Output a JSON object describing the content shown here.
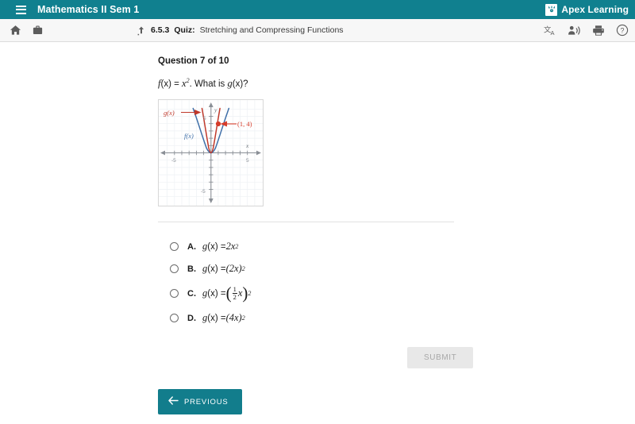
{
  "topbar": {
    "menu_icon": "hamburger-menu-icon",
    "course_title": "Mathematics II Sem 1",
    "brand_name": "Apex Learning",
    "brand_mark_icon": "apex-logo-mark",
    "background_color": "#10808f"
  },
  "toolbar": {
    "home_icon": "home-icon",
    "briefcase_icon": "briefcase-icon",
    "upload_icon": "upload-arrow-icon",
    "breadcrumb": {
      "number": "6.5.3",
      "type": "Quiz:",
      "title": "Stretching and Compressing Functions"
    },
    "translate_icon": "translate-icon",
    "read_aloud_icon": "read-aloud-icon",
    "print_icon": "printer-icon",
    "help_icon": "help-question-icon"
  },
  "question": {
    "heading": "Question 7 of 10",
    "stem_f": "f",
    "stem_fx": "(x) = ",
    "stem_x": "x",
    "stem_exp": "2",
    "stem_rest": ". What is ",
    "stem_g": "g",
    "stem_gx": "(x)?"
  },
  "graph": {
    "label_g": "g(x)",
    "label_f": "f(x)",
    "point_label": "(1, 4)",
    "x_axis_label": "x",
    "y_axis_label": "y",
    "tick_x_neg": "-5",
    "tick_x_pos": "5",
    "tick_y_pos": "5",
    "tick_y_neg": "-5",
    "curve_f_color": "#3f6fa8",
    "curve_g_color": "#c0392b",
    "point_color": "#d63c2a"
  },
  "choices": [
    {
      "letter": "A.",
      "g": "g",
      "paren": "(x) = ",
      "expr": "2x",
      "exp": "2",
      "selected": false
    },
    {
      "letter": "B.",
      "g": "g",
      "paren": "(x) = ",
      "expr": "(2x)",
      "exp": "2",
      "selected": false
    },
    {
      "letter": "C.",
      "g": "g",
      "paren": "(x) = ",
      "frac_num": "1",
      "frac_den": "2",
      "frac_var": "x",
      "exp": "2",
      "selected": false
    },
    {
      "letter": "D.",
      "g": "g",
      "paren": "(x) = ",
      "expr": "(4x)",
      "exp": "2",
      "selected": false
    }
  ],
  "buttons": {
    "submit_label": "SUBMIT",
    "submit_enabled": false,
    "previous_label": "PREVIOUS",
    "previous_color": "#127d8c",
    "previous_icon": "arrow-left-icon"
  },
  "chart_data": {
    "type": "line",
    "title": "",
    "xlabel": "x",
    "ylabel": "y",
    "xlim": [
      -6,
      6
    ],
    "ylim": [
      -6,
      6
    ],
    "grid": true,
    "legend": "inline-labels",
    "series": [
      {
        "name": "f(x)",
        "color": "#3f6fa8",
        "equation": "f(x) = x^2",
        "x": [
          -2.45,
          -2,
          -1.5,
          -1,
          -0.5,
          0,
          0.5,
          1,
          1.5,
          2,
          2.45
        ],
        "values": [
          6,
          4,
          2.25,
          1,
          0.25,
          0,
          0.25,
          1,
          2.25,
          4,
          6
        ]
      },
      {
        "name": "g(x)",
        "color": "#c0392b",
        "equation": "g(x) = 4x^2",
        "x": [
          -1.22,
          -1,
          -0.75,
          -0.5,
          -0.25,
          0,
          0.25,
          0.5,
          0.75,
          1,
          1.22
        ],
        "values": [
          6,
          4,
          2.25,
          1,
          0.25,
          0,
          0.25,
          1,
          2.25,
          4,
          6
        ]
      }
    ],
    "annotations": [
      {
        "text": "(1, 4)",
        "x": 1,
        "y": 4,
        "color": "#d63c2a"
      },
      {
        "text": "g(x)",
        "color": "#c0392b"
      },
      {
        "text": "f(x)",
        "color": "#3f6fa8"
      }
    ],
    "xticks": [
      -5,
      5
    ],
    "yticks": [
      -5,
      5
    ]
  }
}
